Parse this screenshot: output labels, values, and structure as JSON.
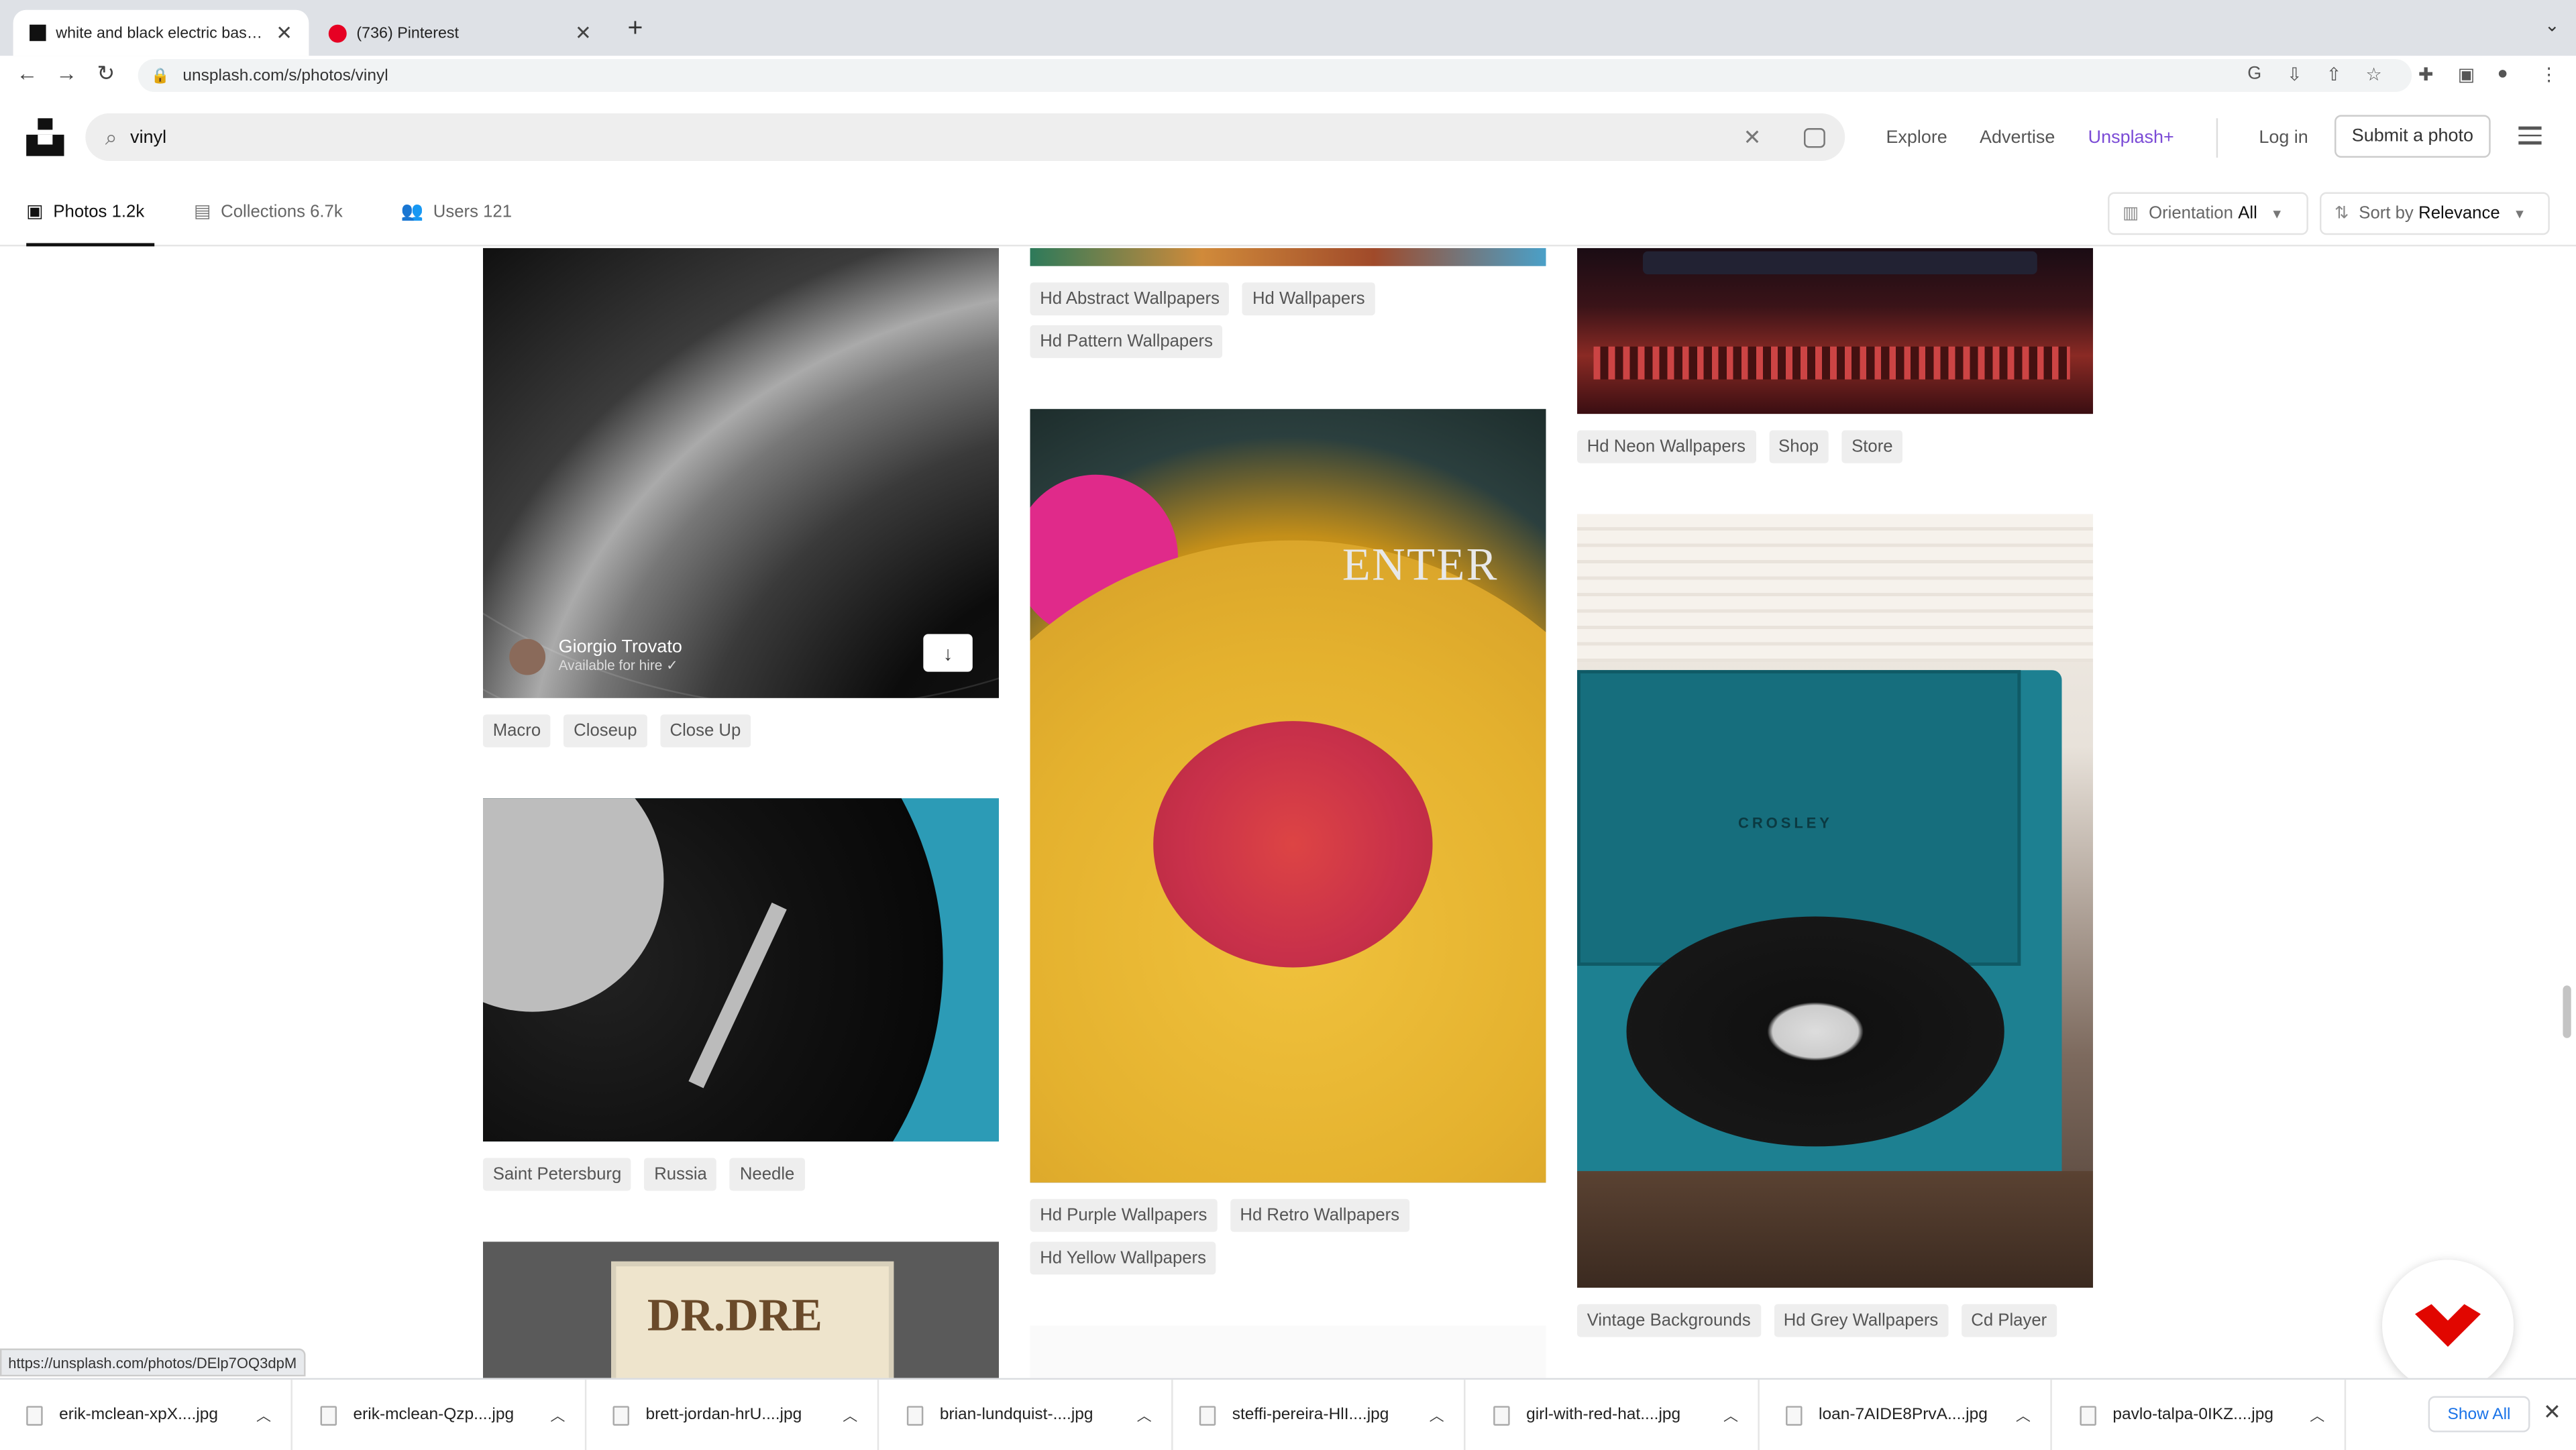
{
  "browser": {
    "tabs": [
      {
        "title": "white and black electric bass guitar"
      },
      {
        "title": "(736) Pinterest"
      }
    ],
    "url": "unsplash.com/s/photos/vinyl"
  },
  "header": {
    "search_query": "vinyl",
    "nav": {
      "explore": "Explore",
      "advertise": "Advertise",
      "plus": "Unsplash+"
    },
    "login": "Log in",
    "submit": "Submit a photo"
  },
  "subnav": {
    "photos": "Photos",
    "photos_count": "1.2k",
    "collections": "Collections",
    "collections_count": "6.7k",
    "users": "Users",
    "users_count": "121",
    "orientation_label": "Orientation",
    "orientation_value": "All",
    "sort_label": "Sort by",
    "sort_value": "Relevance"
  },
  "col1": {
    "photo1": {
      "author": "Giorgio Trovato",
      "hire": "Available for hire",
      "tags": [
        "Macro",
        "Closeup",
        "Close Up"
      ]
    },
    "photo2": {
      "tags": [
        "Saint Petersburg",
        "Russia",
        "Needle"
      ]
    },
    "photo3": {
      "text": "DR.DRE"
    }
  },
  "col2": {
    "photo1": {
      "tags": [
        "Hd Abstract Wallpapers",
        "Hd Wallpapers",
        "Hd Pattern Wallpapers"
      ]
    },
    "photo2": {
      "text": "ENTER",
      "tags": [
        "Hd Purple Wallpapers",
        "Hd Retro Wallpapers",
        "Hd Yellow Wallpapers"
      ]
    }
  },
  "col3": {
    "photo1": {
      "tags": [
        "Hd Neon Wallpapers",
        "Shop",
        "Store"
      ]
    },
    "photo2": {
      "brand": "CROSLEY",
      "tags": [
        "Vintage Backgrounds",
        "Hd Grey Wallpapers",
        "Cd Player"
      ]
    }
  },
  "status_url": "https://unsplash.com/photos/DElp7OQ3dpM",
  "downloads": {
    "files": [
      "erik-mclean-xpX....jpg",
      "erik-mclean-Qzp....jpg",
      "brett-jordan-hrU....jpg",
      "brian-lundquist-....jpg",
      "steffi-pereira-HlI....jpg",
      "girl-with-red-hat....jpg",
      "loan-7AIDE8PrvA....jpg",
      "pavlo-talpa-0IKZ....jpg"
    ],
    "show_all": "Show All"
  },
  "colors": {
    "accent_plus": "#7b4bd6",
    "fab": "#e10600"
  }
}
